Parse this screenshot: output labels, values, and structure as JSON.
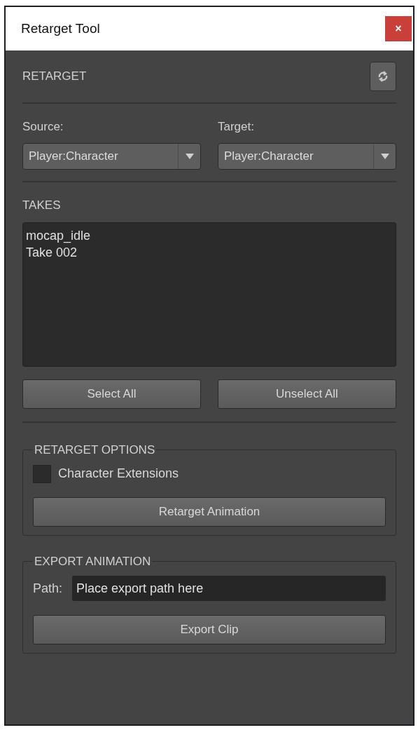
{
  "window": {
    "title": "Retarget Tool",
    "close": "×"
  },
  "retarget": {
    "heading": "RETARGET",
    "source": {
      "label": "Source:",
      "value": "Player:Character"
    },
    "target": {
      "label": "Target:",
      "value": "Player:Character"
    }
  },
  "takes": {
    "heading": "TAKES",
    "items": [
      "mocap_idle",
      "Take 002"
    ],
    "buttons": [
      "Select All",
      "Unselect All"
    ]
  },
  "retarget_options": {
    "title": "RETARGET OPTIONS",
    "checkbox": {
      "label": "Character Extensions",
      "checked": false
    },
    "button": "Retarget Animation"
  },
  "export_animation": {
    "title": "EXPORT ANIMATION",
    "path": {
      "label": "Path:",
      "value": "Place export path here"
    },
    "button": "Export Clip"
  }
}
